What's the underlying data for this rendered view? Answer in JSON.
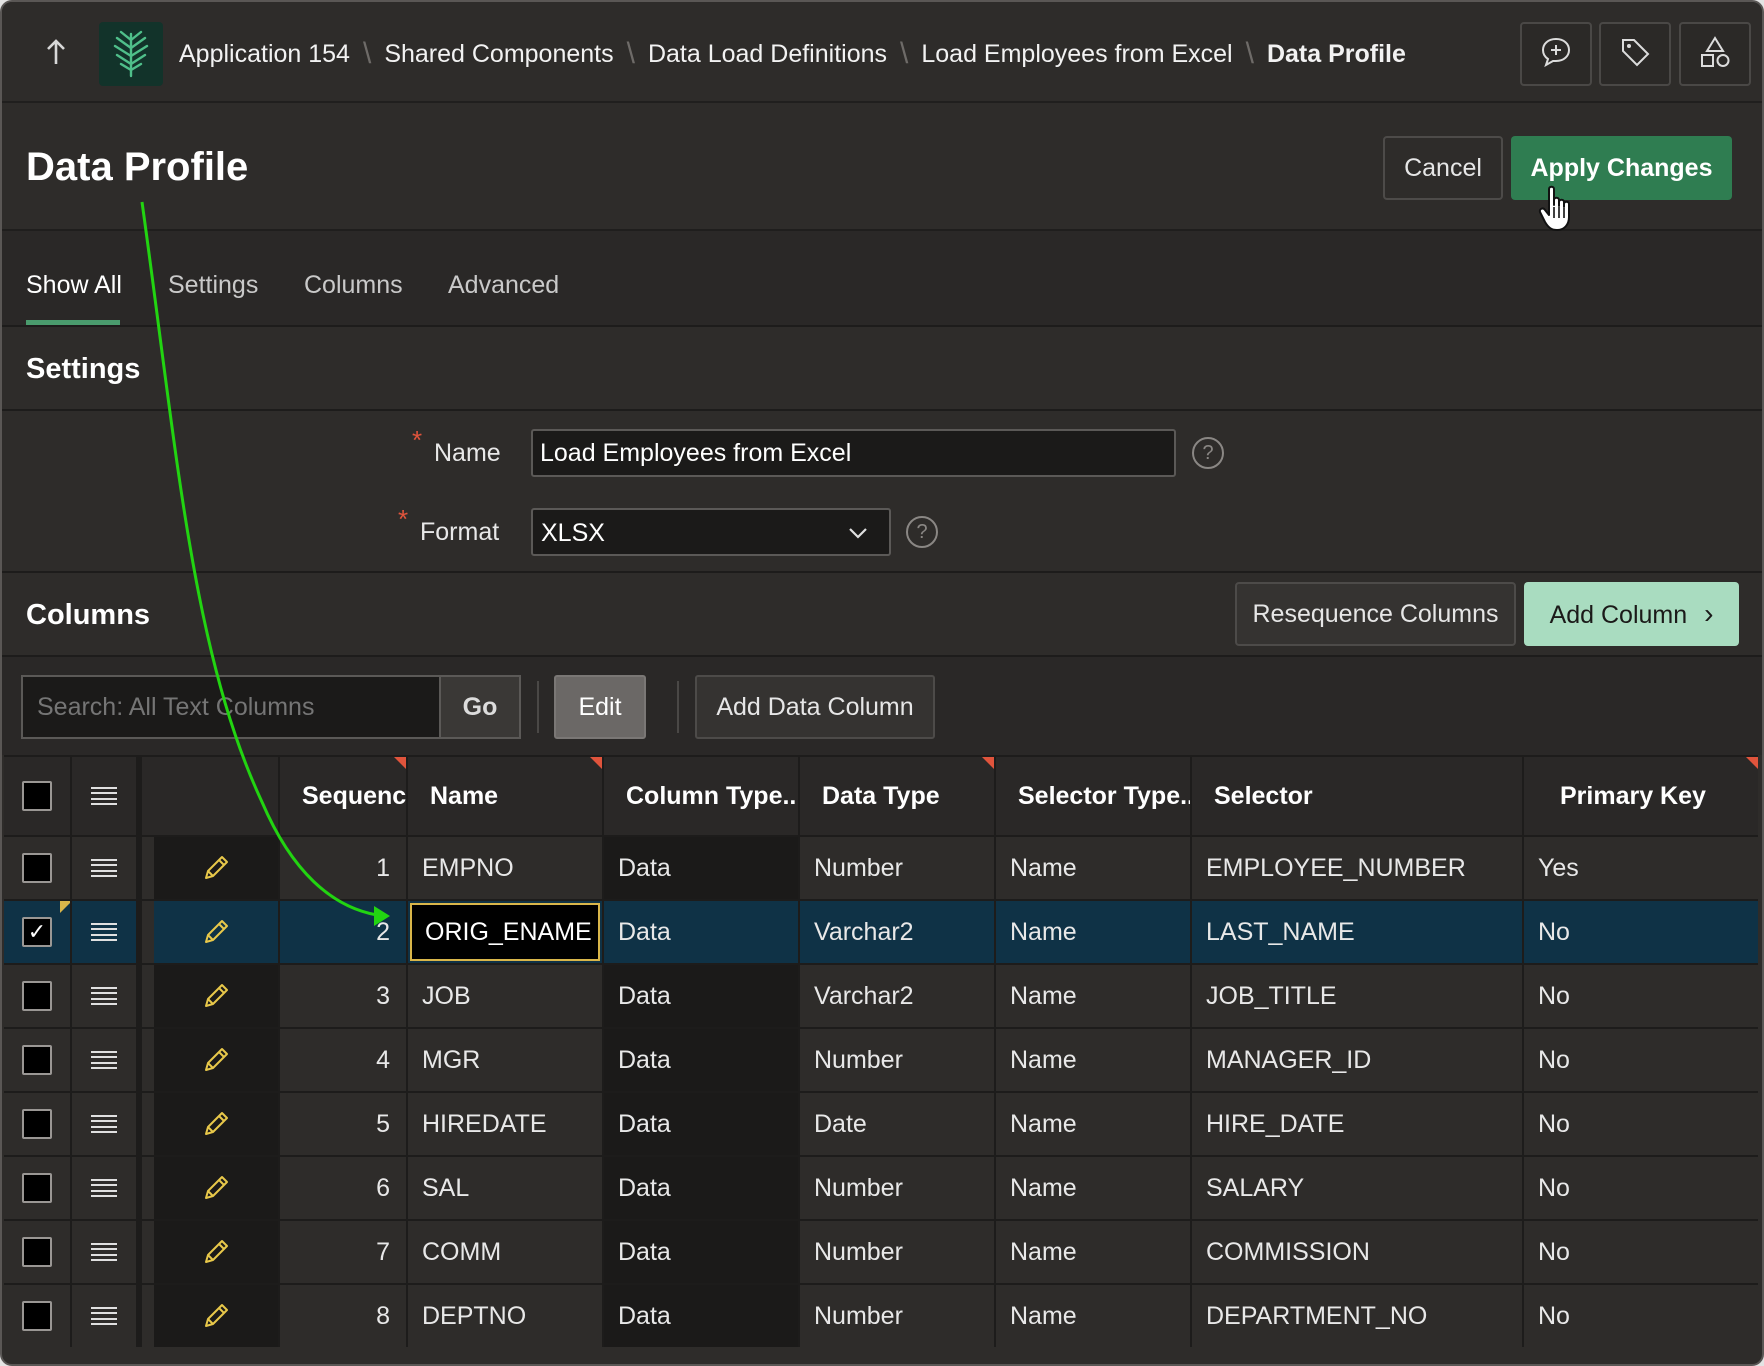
{
  "breadcrumb": {
    "items": [
      "Application 154",
      "Shared Components",
      "Data Load Definitions",
      "Load Employees from Excel",
      "Data Profile"
    ]
  },
  "icons": {
    "up": "up-arrow-icon",
    "logo": "tree-logo-icon",
    "header_buttons": [
      "add-comment-icon",
      "tag-icon",
      "shapes-icon"
    ],
    "help": "?",
    "dropdown": "chevron-down-icon",
    "row_menu": "hamburger-icon",
    "row_edit": "pencil-icon",
    "check": "✓",
    "chevron_right": "›"
  },
  "page": {
    "title": "Data Profile",
    "cancel_label": "Cancel",
    "apply_label": "Apply Changes"
  },
  "tabs": [
    "Show All",
    "Settings",
    "Columns",
    "Advanced"
  ],
  "settings": {
    "title": "Settings",
    "name_label": "Name",
    "name_value": "Load Employees from Excel",
    "format_label": "Format",
    "format_value": "XLSX"
  },
  "columns_region": {
    "title": "Columns",
    "resequence_label": "Resequence Columns",
    "add_column_label": "Add Column"
  },
  "toolbar": {
    "search_placeholder": "Search: All Text Columns",
    "go_label": "Go",
    "edit_label": "Edit",
    "add_data_column_label": "Add Data Column"
  },
  "grid": {
    "headers": [
      "Sequence",
      "Name",
      "Column Type...",
      "Data Type",
      "Selector Type...",
      "Selector",
      "Primary Key"
    ],
    "rows": [
      {
        "seq": "1",
        "name": "EMPNO",
        "ctype": "Data",
        "dtype": "Number",
        "stype": "Name",
        "selector": "EMPLOYEE_NUMBER",
        "pk": "Yes"
      },
      {
        "seq": "2",
        "name": "ORIG_ENAME",
        "ctype": "Data",
        "dtype": "Varchar2",
        "stype": "Name",
        "selector": "LAST_NAME",
        "pk": "No"
      },
      {
        "seq": "3",
        "name": "JOB",
        "ctype": "Data",
        "dtype": "Varchar2",
        "stype": "Name",
        "selector": "JOB_TITLE",
        "pk": "No"
      },
      {
        "seq": "4",
        "name": "MGR",
        "ctype": "Data",
        "dtype": "Number",
        "stype": "Name",
        "selector": "MANAGER_ID",
        "pk": "No"
      },
      {
        "seq": "5",
        "name": "HIREDATE",
        "ctype": "Data",
        "dtype": "Date",
        "stype": "Name",
        "selector": "HIRE_DATE",
        "pk": "No"
      },
      {
        "seq": "6",
        "name": "SAL",
        "ctype": "Data",
        "dtype": "Number",
        "stype": "Name",
        "selector": "SALARY",
        "pk": "No"
      },
      {
        "seq": "7",
        "name": "COMM",
        "ctype": "Data",
        "dtype": "Number",
        "stype": "Name",
        "selector": "COMMISSION",
        "pk": "No"
      },
      {
        "seq": "8",
        "name": "DEPTNO",
        "ctype": "Data",
        "dtype": "Number",
        "stype": "Name",
        "selector": "DEPARTMENT_NO",
        "pk": "No"
      }
    ],
    "selected_row": 2
  },
  "colors": {
    "accent_green": "#2f7d51",
    "light_green": "#a9dcc0",
    "selected_row": "#0f3246",
    "annotation_arrow": "#22d411",
    "required_star": "#e0543c"
  }
}
